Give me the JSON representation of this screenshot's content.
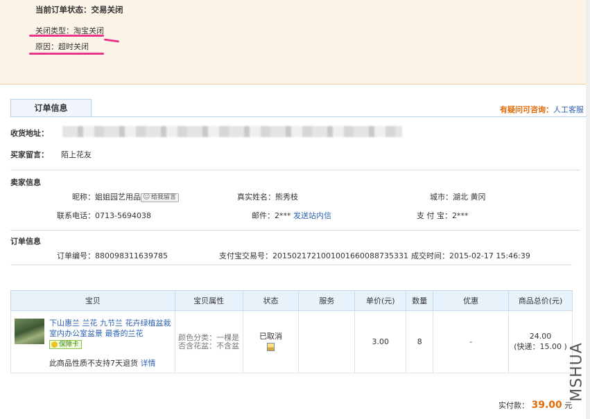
{
  "status": {
    "label": "当前订单状态：",
    "value": "交易关闭",
    "close_type_label": "关闭类型：",
    "close_type_value": "淘宝关闭",
    "reason_label": "原因：",
    "reason_value": "超时关闭"
  },
  "tabs": {
    "order_info": "订单信息"
  },
  "help": {
    "text": "有疑问可咨询：",
    "link": "人工客服"
  },
  "shipping": {
    "address_label": "收货地址：",
    "buyer_message_label": "买家留言：",
    "buyer_message": "陌上花友"
  },
  "seller": {
    "section_title": "卖家信息",
    "nickname_label": "昵称：",
    "nickname": "姐姐园艺用品",
    "message_button": "给我留言",
    "realname_label": "真实姓名：",
    "realname": "熊秀枝",
    "city_label": "城市：",
    "city": "湖北 黄冈",
    "phone_label": "联系电话：",
    "phone": "0713-5694038",
    "email_label": "邮件：",
    "email": "2***",
    "send_msg_link": "发送站内信",
    "alipay_label": "支 付 宝：",
    "alipay": "2***"
  },
  "order": {
    "section_title": "订单信息",
    "number_label": "订单编号：",
    "number": "880098311639785",
    "alipay_no_label": "支付宝交易号：",
    "alipay_no": "2015021721001001660088735331",
    "deal_time_label": "成交时间：",
    "deal_time": "2015-02-17 15:46:39"
  },
  "table": {
    "headers": [
      "宝贝",
      "宝贝属性",
      "状态",
      "服务",
      "单价(元)",
      "数量",
      "优惠",
      "商品总价(元)"
    ],
    "item": {
      "title": "下山惠兰 兰花 九节兰 花卉绿植盆栽室内办公室盆景 最香的兰花",
      "badge": "保障卡",
      "no_return": "此商品性质不支持7天退货",
      "detail_link": "详情",
      "attributes": "颜色分类：一棵是否含花盆：不含盆",
      "status": "已取消",
      "service": "",
      "unit_price": "3.00",
      "quantity": "8",
      "discount": "-",
      "total": "24.00",
      "shipping": "(快递：15.00 )"
    }
  },
  "payment": {
    "label": "实付款：",
    "amount": "39.00",
    "unit": "元"
  },
  "watermark": "MSHUA",
  "colors": {
    "accent": "#e36c09",
    "link": "#2b62b5",
    "highlight": "#e8338a",
    "panel_bg": "#fdf4e8"
  }
}
